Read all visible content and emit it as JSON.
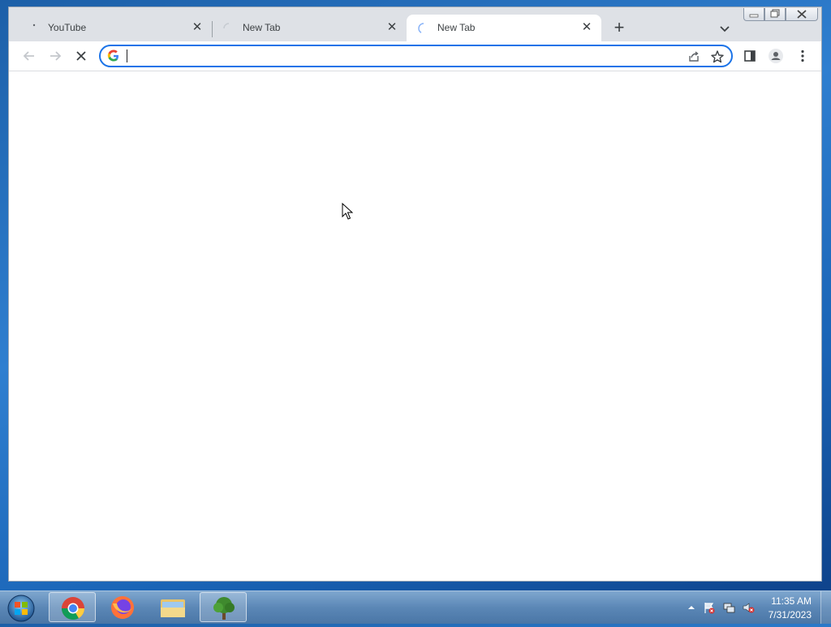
{
  "browser": {
    "tabs": [
      {
        "title": "YouTube",
        "active": false
      },
      {
        "title": "New Tab",
        "active": false
      },
      {
        "title": "New Tab",
        "active": true
      }
    ],
    "omnibox": {
      "value": "",
      "placeholder": ""
    },
    "accent_color": "#1a73e8"
  },
  "taskbar": {
    "apps": [
      "Google Chrome",
      "Mozilla Firefox",
      "Windows Explorer",
      "Tree App"
    ],
    "clock": {
      "time": "11:35 AM",
      "date": "7/31/2023"
    }
  }
}
